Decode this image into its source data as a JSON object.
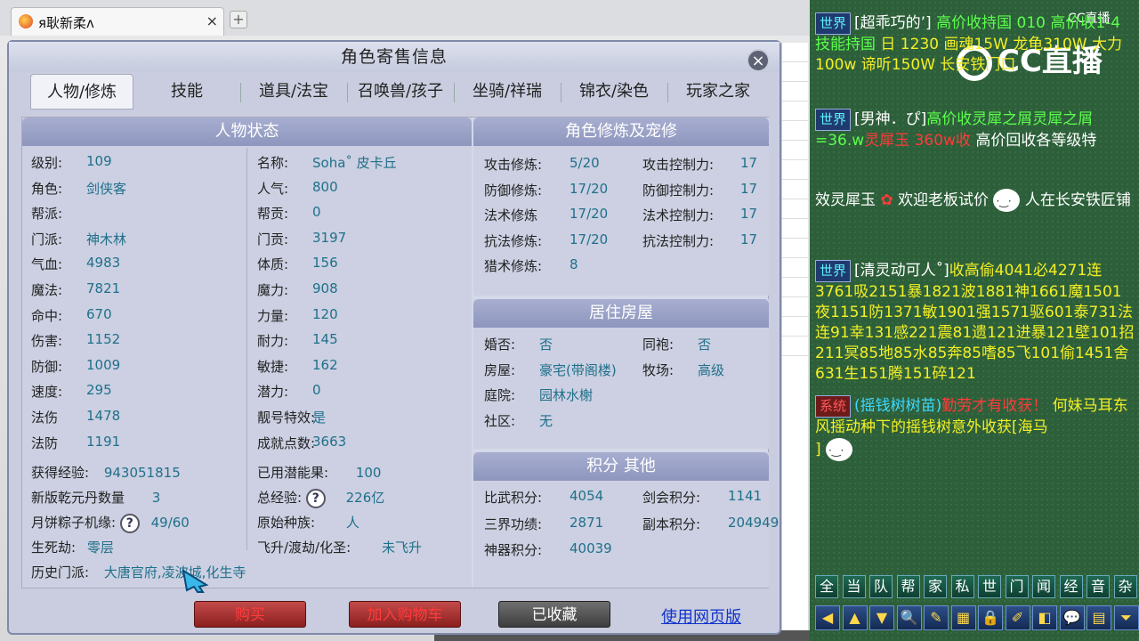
{
  "browser": {
    "tab_title": "я耿新柔ʌ",
    "close": "×",
    "new_tab": "+"
  },
  "dialog": {
    "title": "角色寄售信息",
    "close": "×",
    "tabs": [
      "人物/修炼",
      "技能",
      "道具/法宝",
      "召唤兽/孩子",
      "坐骑/祥瑞",
      "锦衣/染色",
      "玩家之家"
    ]
  },
  "status": {
    "header": "人物状态",
    "left": [
      [
        "级别:",
        "109"
      ],
      [
        "角色:",
        "剑侠客"
      ],
      [
        "帮派:",
        ""
      ],
      [
        "门派:",
        "神木林"
      ],
      [
        "气血:",
        "4983"
      ],
      [
        "魔法:",
        "7821"
      ],
      [
        "命中:",
        "670"
      ],
      [
        "伤害:",
        "1152"
      ],
      [
        "防御:",
        "1009"
      ],
      [
        "速度:",
        "295"
      ],
      [
        "法伤",
        "1478"
      ],
      [
        "法防",
        "1191"
      ]
    ],
    "right": [
      [
        "名称:",
        "Soha˚ 皮卡丘"
      ],
      [
        "人气:",
        "800"
      ],
      [
        "帮贡:",
        "0"
      ],
      [
        "门贡:",
        "3197"
      ],
      [
        "体质:",
        "156"
      ],
      [
        "魔力:",
        "908"
      ],
      [
        "力量:",
        "120"
      ],
      [
        "耐力:",
        "145"
      ],
      [
        "敏捷:",
        "162"
      ],
      [
        "潜力:",
        "0"
      ],
      [
        "靓号特效:",
        "是"
      ],
      [
        "成就点数:",
        "3663"
      ]
    ],
    "exp_label": "获得经验:",
    "exp_value": "943051815",
    "qianyuan_label": "新版乾元丹数量",
    "qianyuan_value": "3",
    "mooncake_label": "月饼粽子机缘:",
    "mooncake_value": "49/60",
    "shengsi_label": "生死劫:",
    "shengsi_value": "零层",
    "used_fruit_label": "已用潜能果:",
    "used_fruit_value": "100",
    "total_exp_label": "总经验:",
    "total_exp_value": "226亿",
    "race_label": "原始种族:",
    "race_value": "人",
    "ascend_label": "飞升/渡劫/化圣:",
    "ascend_value": "未飞升",
    "history_label": "历史门派:",
    "history_value": "大唐官府,凌波城,化生寺",
    "help": "?"
  },
  "cultivation": {
    "header": "角色修炼及宠修",
    "rows": [
      [
        "攻击修炼:",
        "5/20",
        "攻击控制力:",
        "17"
      ],
      [
        "防御修炼:",
        "17/20",
        "防御控制力:",
        "17"
      ],
      [
        "法术修炼",
        "17/20",
        "法术控制力:",
        "17"
      ],
      [
        "抗法修炼:",
        "17/20",
        "抗法控制力:",
        "17"
      ],
      [
        "猎术修炼:",
        "8",
        "",
        ""
      ]
    ]
  },
  "house": {
    "header": "居住房屋",
    "rows": [
      [
        "婚否:",
        "否",
        "同袍:",
        "否"
      ],
      [
        "房屋:",
        "豪宅(带阁楼)",
        "牧场:",
        "高级"
      ],
      [
        "庭院:",
        "园林水榭",
        "",
        ""
      ],
      [
        "社区:",
        "无",
        "",
        ""
      ]
    ]
  },
  "score": {
    "header": "积分 其他",
    "rows": [
      [
        "比武积分:",
        "4054",
        "剑会积分:",
        "1141"
      ],
      [
        "三界功绩:",
        "2871",
        "副本积分:",
        "204949"
      ],
      [
        "神器积分:",
        "40039",
        "",
        ""
      ]
    ]
  },
  "buttons": {
    "buy": "购买",
    "cart": "加入购物车",
    "fav": "已收藏",
    "web": "使用网页版"
  },
  "chat": {
    "cc_logo": "CC直播",
    "cc_mini": "CC直播",
    "m1_ch": "世界",
    "m1_name": "[超乖巧的’]",
    "m1_text": "高价收持国 010 高价收1-4技能持国",
    "m1_more": "日 1230 画魂15W 龙龟310W 大力100w 谛听150W 长安铁门口",
    "m2_ch": "世界",
    "m2_name": "[男神．ぴ]",
    "m2_text": "高价收灵犀之屑灵犀之屑=36.w",
    "m2_red": "灵犀玉 360w收",
    "m2_tail": "高价回收各等级特",
    "m3_text": "效灵犀玉",
    "m3_text2": "欢迎老板试价",
    "m3_text3": "人在长安铁匠铺",
    "m4_ch": "世界",
    "m4_name": "[清灵动可人˚]",
    "m4_text": "收高偷4041必4271连3761吸2151暴1821波1881神1661魔1501夜1151防1371敏1901强1571驱601泰731法连91幸131感221震81遗121进暴121壁101招211冥85地85水85奔85嗜85飞101偷1451舍631生151腾151碎121",
    "m5_ch": "系统",
    "m5_name": "(摇钱树树苗)",
    "m5_red": "勤劳才有收获！",
    "m5_text": "何妹马耳东风摇动种下的摇钱树意外收获[海马",
    "m5_end": "]",
    "bar1": [
      "全",
      "当",
      "队",
      "帮",
      "家",
      "私",
      "世",
      "门",
      "闻",
      "经",
      "音",
      "杂"
    ],
    "bar2": [
      "◀",
      "▲",
      "▼",
      "🔍",
      "✎",
      "▦",
      "🔒",
      "✐",
      "◧",
      "💬",
      "▤",
      "⏷"
    ]
  }
}
